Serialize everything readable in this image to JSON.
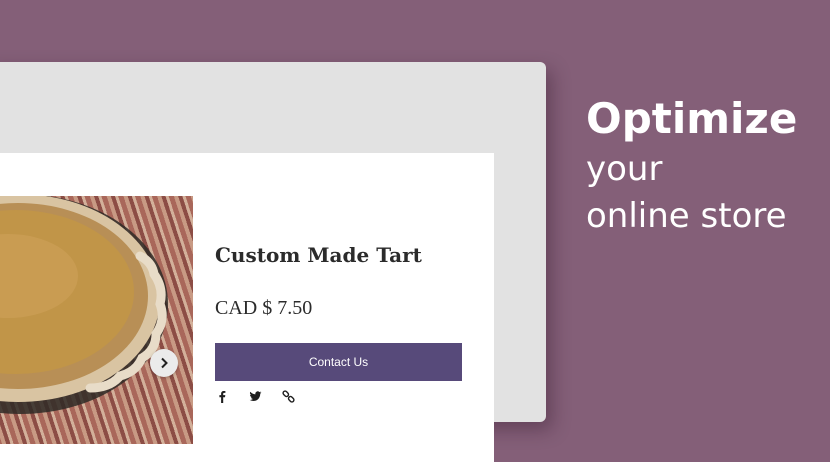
{
  "colors": {
    "background": "#845f78",
    "device_frame": "#e2e2e2",
    "button": "#574a7a",
    "text_dark": "#2b2b2b",
    "tagline": "#ffffff"
  },
  "product": {
    "title": "Custom Made Tart",
    "price": "CAD $ 7.50",
    "contact_label": "Contact Us",
    "image_subject": "pumpkin-pie-photo",
    "next_icon": "chevron-right-icon"
  },
  "share": {
    "icons": [
      "facebook-icon",
      "twitter-icon",
      "link-icon"
    ]
  },
  "tagline": {
    "line1": "Optimize",
    "line2": "your",
    "line3": "online store"
  }
}
